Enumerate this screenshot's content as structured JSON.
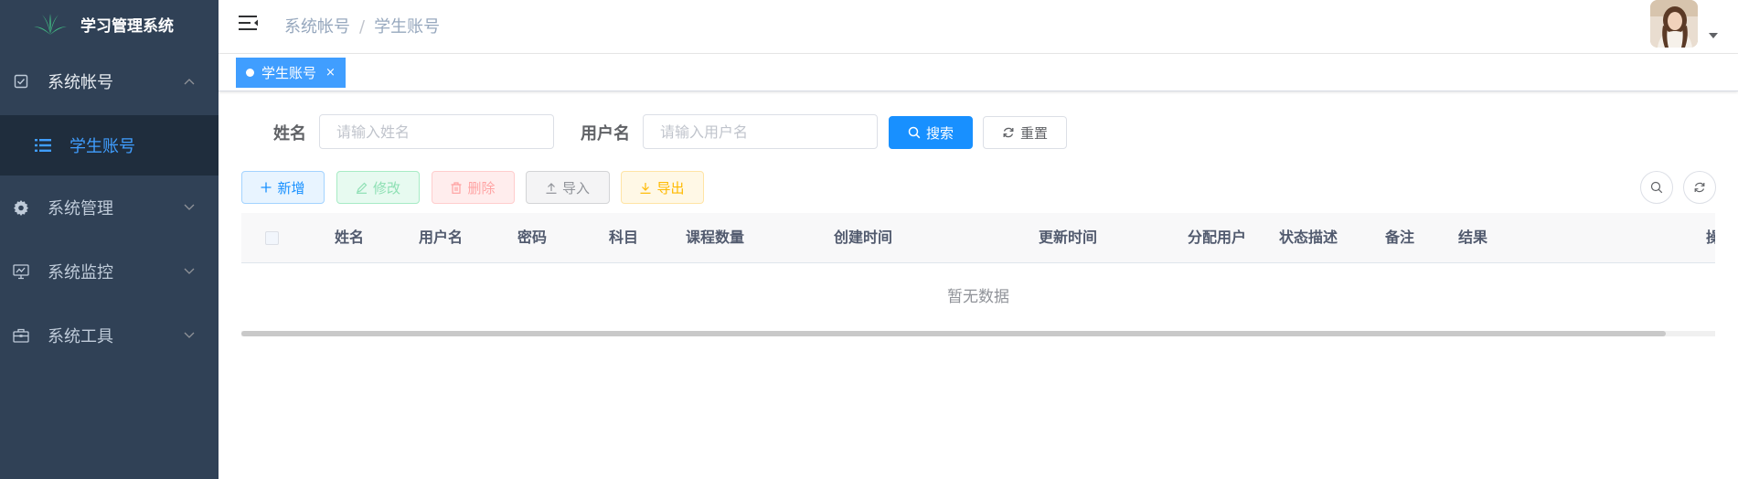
{
  "app": {
    "title": "学习管理系统"
  },
  "sidebar": {
    "items": [
      {
        "label": "系统帐号",
        "icon": "checkbox-icon",
        "open": true,
        "children": [
          {
            "label": "学生账号",
            "icon": "list-icon",
            "active": true
          }
        ]
      },
      {
        "label": "系统管理",
        "icon": "gear-icon"
      },
      {
        "label": "系统监控",
        "icon": "monitor-icon"
      },
      {
        "label": "系统工具",
        "icon": "toolbox-icon"
      }
    ]
  },
  "breadcrumb": {
    "items": [
      "系统帐号",
      "学生账号"
    ],
    "separator": "/"
  },
  "tags": [
    {
      "label": "学生账号",
      "close": "×"
    }
  ],
  "search": {
    "name_label": "姓名",
    "name_placeholder": "请输入姓名",
    "username_label": "用户名",
    "username_placeholder": "请输入用户名",
    "search_button": "搜索",
    "reset_button": "重置"
  },
  "toolbar": {
    "add": "新增",
    "edit": "修改",
    "delete": "删除",
    "import": "导入",
    "export": "导出"
  },
  "table": {
    "columns": [
      "姓名",
      "用户名",
      "密码",
      "科目",
      "课程数量",
      "创建时间",
      "更新时间",
      "分配用户",
      "状态描述",
      "备注",
      "结果",
      "操"
    ],
    "rows": [],
    "empty_text": "暂无数据"
  },
  "colors": {
    "sidebar_bg": "#304156",
    "sidebar_active_bg": "#1f2d3d",
    "accent": "#1890ff",
    "tag_active": "#409eff"
  }
}
